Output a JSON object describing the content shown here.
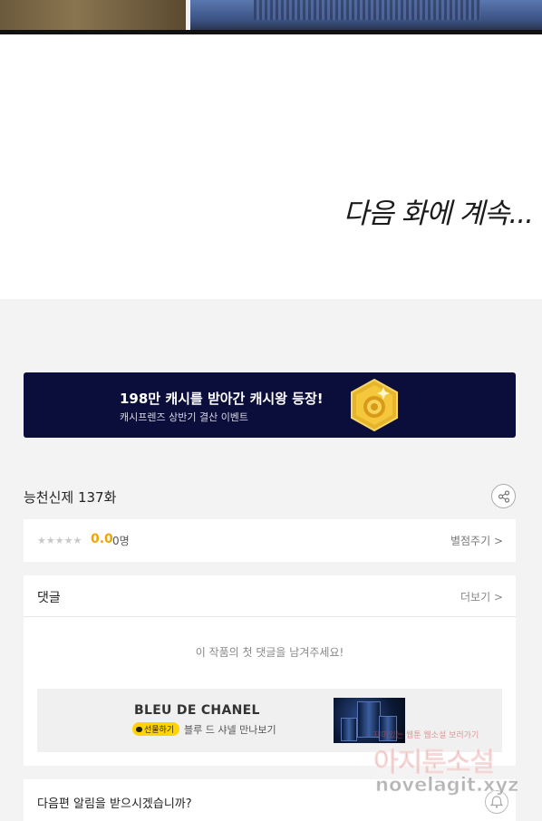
{
  "comic": {
    "end_text": "다음 화에 계속..."
  },
  "banner": {
    "title": "198만 캐시를 받아간 캐시왕 등장!",
    "subtitle": "캐시프렌즈 상반기 결산 이벤트",
    "background_color": "#0b0d3a",
    "icon": "gold-coin-icon"
  },
  "work": {
    "title": "능천신제 137화",
    "share_icon": "share-icon"
  },
  "rating": {
    "stars_filled": 0,
    "stars_total": 5,
    "score": "0.0",
    "count": "0명",
    "rate_label": "별점주기 >",
    "score_color": "#f2a400"
  },
  "comments": {
    "title": "댓글",
    "more_label": "더보기 >",
    "empty_message": "이 작품의 첫 댓글을 남겨주세요!"
  },
  "ad": {
    "title": "BLEU DE CHANEL",
    "badge_label": "선물하기",
    "description": "블루 드 샤넬 만나보기"
  },
  "notify": {
    "question": "다음편 알림을 받으시겠습니까?",
    "bell_icon": "bell-icon"
  },
  "watermark": {
    "line1": "재미있는 웹툰 웹소설 보러가기",
    "big": "아지툰소설",
    "url": "novelagit.xyz"
  }
}
